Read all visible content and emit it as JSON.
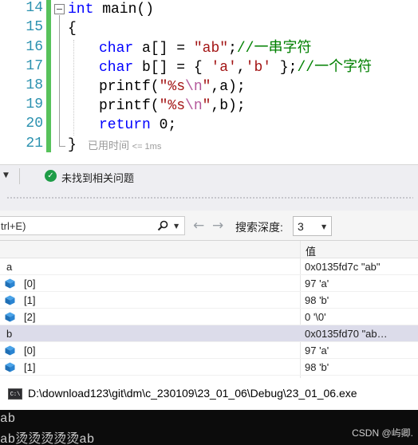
{
  "editor": {
    "line_numbers": [
      "14",
      "15",
      "16",
      "17",
      "18",
      "19",
      "20",
      "21"
    ],
    "lines": {
      "l14": {
        "kw": "int",
        "rest": " main()"
      },
      "l15": {
        "text": "{"
      },
      "l16": {
        "kw": "char",
        "mid": " a[] = ",
        "str": "\"ab\"",
        "punct": ";",
        "cmt": "//一串字符"
      },
      "l17": {
        "kw": "char",
        "mid": " b[] = { ",
        "str1": "'a'",
        "comma": ",",
        "str2": "'b'",
        "end": " };",
        "cmt": "//一个字符"
      },
      "l18": {
        "pre": "printf(",
        "str_a": "\"%s",
        "esc": "\\n",
        "str_b": "\"",
        "post": ",a);"
      },
      "l19": {
        "pre": "printf(",
        "str_a": "\"%s",
        "esc": "\\n",
        "str_b": "\"",
        "post": ",b);"
      },
      "l20": {
        "kw": "return",
        "rest": " 0;"
      },
      "l21": {
        "text": "}"
      }
    },
    "perf_tip": {
      "label": "已用时间",
      "value": "<= 1ms"
    }
  },
  "status_bar": {
    "issues_text": "未找到相关问题"
  },
  "watch": {
    "search_placeholder": "trl+E)",
    "depth_label": "搜索深度:",
    "depth_value": "3",
    "column_value": "值",
    "rows": [
      {
        "name": "a",
        "value": "0x0135fd7c \"ab\""
      },
      {
        "name": "[0]",
        "value": "97 'a'"
      },
      {
        "name": "[1]",
        "value": "98 'b'"
      },
      {
        "name": "[2]",
        "value": "0 '\\0'"
      },
      {
        "name": "b",
        "value": "0x0135fd70 \"ab…"
      },
      {
        "name": "[0]",
        "value": "97 'a'"
      },
      {
        "name": "[1]",
        "value": "98 'b'"
      }
    ]
  },
  "console": {
    "icon_text": "C:\\",
    "title": "D:\\download123\\git\\dm\\c_230109\\23_01_06\\Debug\\23_01_06.exe",
    "output": [
      "ab",
      "ab烫烫烫烫烫ab"
    ],
    "watermark": "CSDN @屿卿."
  },
  "colors": {
    "keyword": "#0000ff",
    "string": "#a31515",
    "comment": "#008000",
    "line_number": "#2b91af",
    "change_bar": "#57c25b"
  }
}
